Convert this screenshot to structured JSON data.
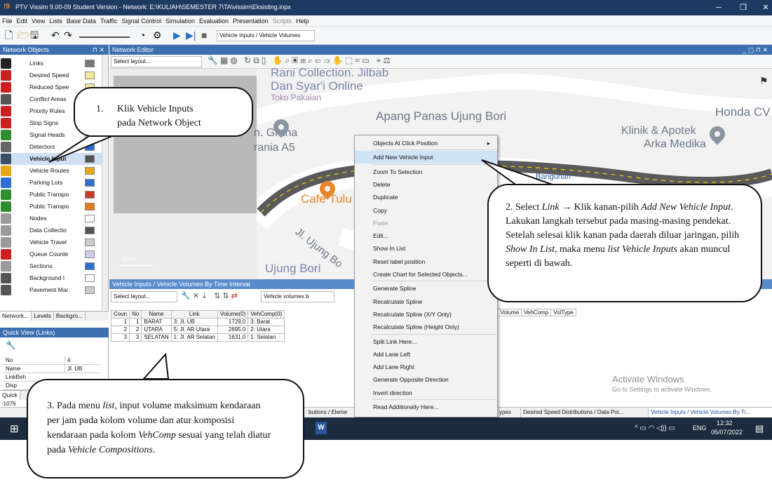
{
  "window": {
    "title": "PTV Vissim 9.00-09 Student Version - Network: E:\\KULIAH\\SEMESTER 7\\TA\\vissim\\Eksisting.inpx",
    "logo": "!9",
    "minimize": "─",
    "maximize": "❐",
    "close": "✕"
  },
  "menu": [
    "File",
    "Edit",
    "View",
    "Lists",
    "Base Data",
    "Traffic",
    "Signal Control",
    "Simulation",
    "Evaluation",
    "Presentation",
    "Scripts",
    "Help"
  ],
  "toolbar": {
    "list_combo": "Vehicle Inputs / Vehicle Volumes"
  },
  "network_objects": {
    "title": "Network Objects",
    "pin": "⊓ ✕",
    "items": [
      {
        "label": "Links",
        "icon": "link-icon",
        "color": "#222222"
      },
      {
        "label": "Desired Speed",
        "icon": "desired-speed-icon",
        "color": "#cc1f1f"
      },
      {
        "label": "Reduced Spee",
        "icon": "reduced-speed-icon",
        "color": "#cc1f1f"
      },
      {
        "label": "Conflict Areas",
        "icon": "conflict-area-icon",
        "color": "#555555"
      },
      {
        "label": "Priority Rules",
        "icon": "priority-rule-icon",
        "color": "#cc1f1f"
      },
      {
        "label": "Stop Signs",
        "icon": "stop-sign-icon",
        "color": "#cc1f1f"
      },
      {
        "label": "Signal Heads",
        "icon": "signal-head-icon",
        "color": "#2f8c2f"
      },
      {
        "label": "Detectors",
        "icon": "detector-icon",
        "color": "#666666"
      },
      {
        "label": "Vehicle Input",
        "icon": "vehicle-input-icon",
        "color": "#3b4d63"
      },
      {
        "label": "Vehicle Routes",
        "icon": "vehicle-route-icon",
        "color": "#e6a817"
      },
      {
        "label": "Parking Lots",
        "icon": "parking-icon",
        "color": "#2a6fd1"
      },
      {
        "label": "Public Transpo",
        "icon": "public-transport-stop-icon",
        "color": "#2f8c2f"
      },
      {
        "label": "Public Transpo",
        "icon": "public-transport-line-icon",
        "color": "#2f8c2f"
      },
      {
        "label": "Nodes",
        "icon": "node-icon",
        "color": "#9a9a9a"
      },
      {
        "label": "Data Collectio",
        "icon": "data-collection-icon",
        "color": "#9a9a9a"
      },
      {
        "label": "Vehicle Travel",
        "icon": "vehicle-travel-time-icon",
        "color": "#9a9a9a"
      },
      {
        "label": "Queue Counte",
        "icon": "queue-counter-icon",
        "color": "#cc1f1f"
      },
      {
        "label": "Sections",
        "icon": "section-icon",
        "color": "#9a9a9a"
      },
      {
        "label": "Background I",
        "icon": "background-image-icon",
        "color": "#555555"
      },
      {
        "label": "Pavement Mar",
        "icon": "pavement-marking-icon",
        "color": "#555555"
      }
    ],
    "tabs": [
      "Network...",
      "Levels",
      "Backgro..."
    ]
  },
  "quick_view": {
    "title": "Quick View (Links)",
    "rows": [
      {
        "key": "No",
        "value": "4"
      },
      {
        "key": "Name",
        "value": "Jl. UB"
      },
      {
        "key": "LinkBeh",
        "value": ""
      },
      {
        "key": "Disp",
        "value": ""
      }
    ],
    "bottom_tab": "Quick",
    "status_num": "-1076"
  },
  "network_editor": {
    "title": "Network Editor",
    "layout_combo": "Select layout...",
    "scale": "50 m",
    "map_labels": [
      "Rani Collection. Jilbab",
      "Dan Syar'i Online",
      "Toko Pakaian",
      "Apang Panas Ujung Bori",
      "Honda CV Ir",
      "Klinik & Apotek",
      "Arka Medika",
      "n. Graha",
      "rania A5",
      "Cafe Tulu",
      "Jl. Ujung Bo",
      "Ujung Bori",
      "Bangunan"
    ]
  },
  "list_panel": {
    "title": "Vehicle Inputs / Vehicle Volumes By Time Interval",
    "layout_combo": "Select layout...",
    "volumes_combo": "Vehicle volumes b",
    "columns": [
      "Coun",
      "No",
      "Name",
      "Link",
      "Volume(0)",
      "VehComp(0)"
    ],
    "rows": [
      [
        "1",
        "1",
        "BARAT",
        "3: Jl. UB",
        "1729,0",
        "3: Barat"
      ],
      [
        "2",
        "2",
        "UTARA",
        "5: Jl. AR Utara",
        "2695,0",
        "2: Utara"
      ],
      [
        "3",
        "3",
        "SELATAN",
        "1: Jl. AR Selatan",
        "1631,0",
        "1: Selatan"
      ]
    ],
    "right_columns": [
      "lnt",
      "Volume",
      "VehComp",
      "VolType"
    ]
  },
  "context_menu": {
    "items": [
      {
        "label": "Objects At Click Position",
        "arrow": "▸"
      },
      {
        "label": "Add New Vehicle Input",
        "highlight": true
      },
      {
        "label": "Zoom To Selection"
      },
      {
        "label": "Delete"
      },
      {
        "label": "Duplicate"
      },
      {
        "label": "Copy"
      },
      {
        "label": "Paste",
        "disabled": true
      },
      {
        "label": "Edit..."
      },
      {
        "label": "Show In List"
      },
      {
        "label": "Reset label position"
      },
      {
        "label": "Create Chart for Selected Objects..."
      },
      {
        "label": "Generate Spline"
      },
      {
        "label": "Recalculate Spline"
      },
      {
        "label": "Recalculate Spline (X/Y Only)"
      },
      {
        "label": "Recalculate Spline (Height Only)"
      },
      {
        "label": "Split Link Here..."
      },
      {
        "label": "Add Lane Left"
      },
      {
        "label": "Add Lane Right"
      },
      {
        "label": "Generate Opposite Direction"
      },
      {
        "label": "Invert direction"
      },
      {
        "label": "Read Additionally Here..."
      }
    ]
  },
  "bottom_tabs": {
    "left": "butions / Eleme",
    "right": [
      "ypes",
      "Desired Speed Distributions / Data Poi...",
      "Vehicle Inputs / Vehicle Volumes By Ti..."
    ]
  },
  "watermark": {
    "title": "Activate Windows",
    "sub": "Go to Settings to activate Windows."
  },
  "taskbar": {
    "tray_icons": "^ ▭ ◠ ◁)) ▭",
    "lang": "ENG",
    "time": "12:32",
    "date": "05/07/2022",
    "notif": "▤"
  },
  "callouts": {
    "c1": {
      "num": "1.",
      "line1": "Klik Vehicle Inputs",
      "line2": "pada Network Object"
    },
    "c2": {
      "p1": "2. Select ",
      "link": "Link",
      "arrow": " → ",
      "p2": "Klik kanan-pilih ",
      "add": "Add New Vehicle Input",
      "p3": ". Lakukan langkah tersebut pada masing-masing pendekat. Setelah selesai klik kanan pada daerah diluar jaringan, pilih ",
      "show": "Show In List",
      "p4": ", maka menu ",
      "list": "list Vehicle Inputs",
      "p5": " akan muncul seperti di bawah."
    },
    "c3": {
      "p1": "3. Pada menu ",
      "list": "list",
      "p2": ", input volume maksimum kendaraan per jam pada kolom volume dan atur komposisi kendaraan pada kolom ",
      "vc": "VehComp",
      "p3": " sesuai yang telah diatur pada ",
      "vcomp": "Vehicle Compositions",
      "p4": "."
    }
  }
}
